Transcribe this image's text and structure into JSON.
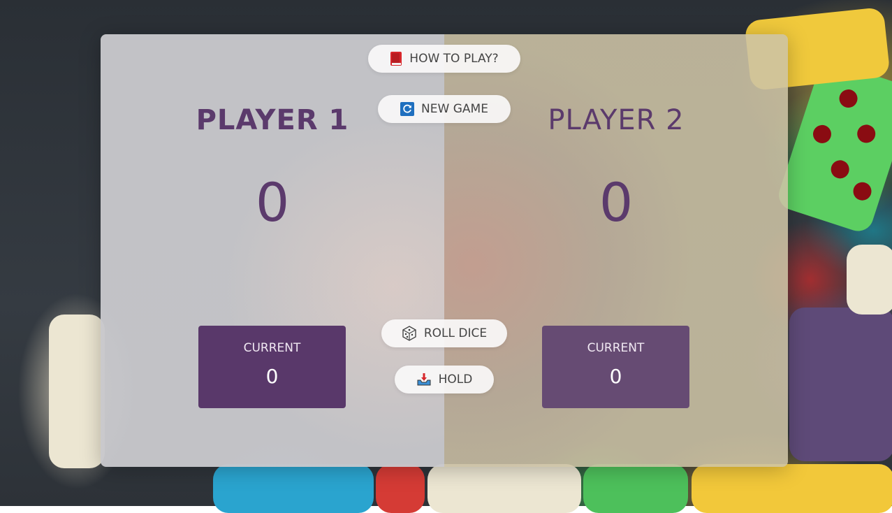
{
  "buttons": {
    "how_to_play": {
      "label": "HOW TO PLAY?",
      "icon": "book-icon"
    },
    "new_game": {
      "label": "NEW GAME",
      "icon": "refresh-icon"
    },
    "roll_dice": {
      "label": "ROLL DICE",
      "icon": "dice-icon"
    },
    "hold": {
      "label": "HOLD",
      "icon": "inbox-tray-icon"
    }
  },
  "players": [
    {
      "name": "PLAYER 1",
      "score": "0",
      "current_label": "CURRENT",
      "current_value": "0",
      "active": true
    },
    {
      "name": "PLAYER 2",
      "score": "0",
      "current_label": "CURRENT",
      "current_value": "0",
      "active": false
    }
  ],
  "colors": {
    "accent": "#5b3a6c",
    "current_active": "#59386a",
    "current_inactive": "#664b73"
  }
}
